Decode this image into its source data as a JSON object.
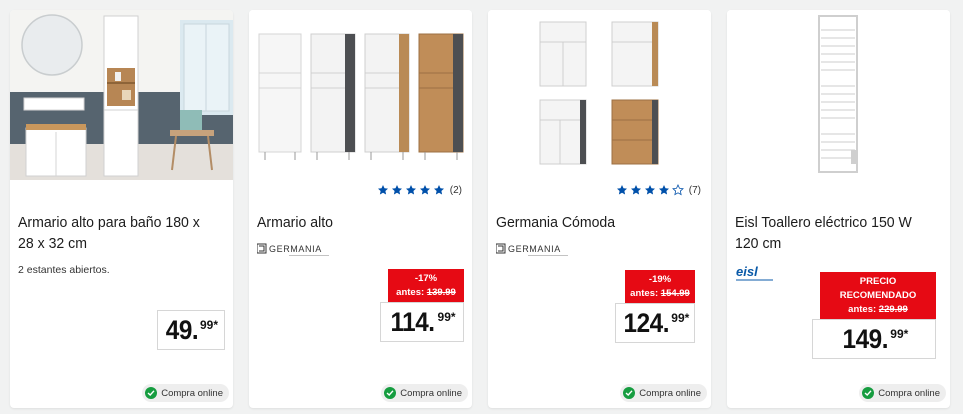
{
  "colors": {
    "promo_red": "#e60a14",
    "star_blue": "#0050aa",
    "online_green": "#169d40"
  },
  "products": [
    {
      "title": "Armario alto para baño 180 x 28 x 32 cm",
      "description": "2 estantes abiertos.",
      "price_int": "49.",
      "price_dec": "99*",
      "online_label": "Compra online"
    },
    {
      "title": "Armario alto",
      "brand": "GERMANIA",
      "rating": {
        "stars": 5,
        "count": "(2)"
      },
      "discount": "-17%",
      "old_price_label": "antes:",
      "old_price": "139.99",
      "price_int": "114.",
      "price_dec": "99*",
      "online_label": "Compra online"
    },
    {
      "title": "Germania Cómoda",
      "brand": "GERMANIA",
      "rating": {
        "stars": 4,
        "count": "(7)"
      },
      "discount": "-19%",
      "old_price_label": "antes:",
      "old_price": "154.99",
      "price_int": "124.",
      "price_dec": "99*",
      "online_label": "Compra online"
    },
    {
      "title": "Eisl Toallero eléctrico 150 W 120 cm",
      "brand": "eisl",
      "promo_label": "PRECIO RECOMENDADO",
      "old_price_label": "antes:",
      "old_price": "229.99",
      "price_int": "149.",
      "price_dec": "99*",
      "online_label": "Compra online"
    }
  ]
}
